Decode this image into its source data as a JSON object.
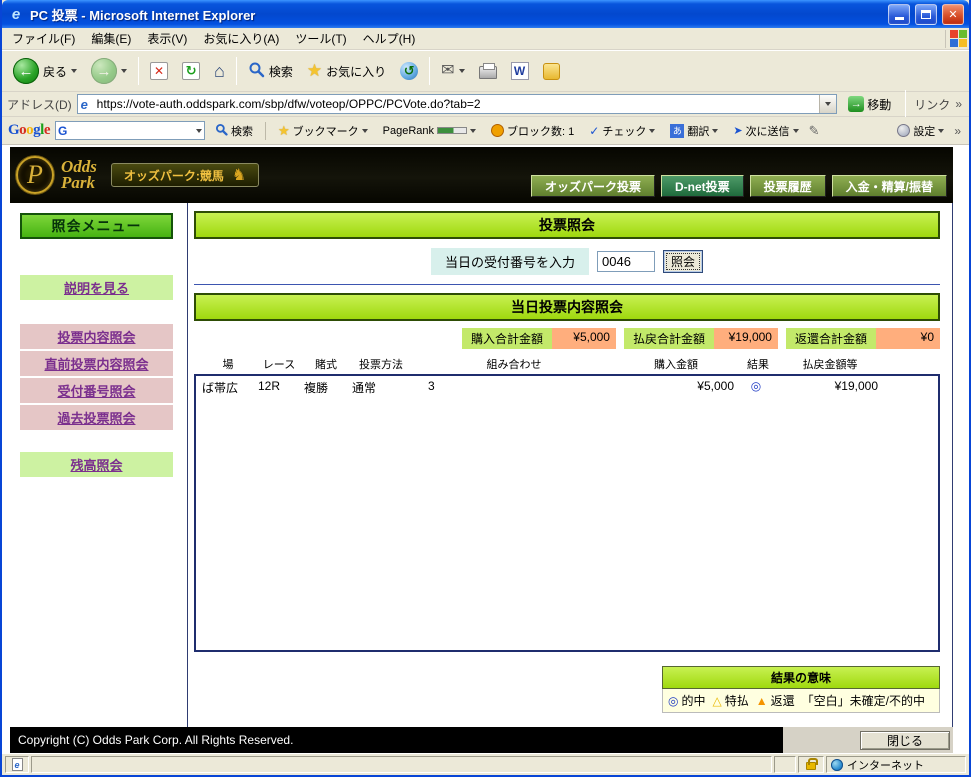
{
  "colors": {
    "titlebar_blue": "#0348CE",
    "chrome_gray": "#ECE9D8",
    "green_bar": "#A9DE28",
    "menu_green_dark": "#46B312",
    "sidebar_pink": "#E5C6C6",
    "sidebar_green": "#CDF2A2",
    "summary_label_green": "#C3E96A",
    "summary_value_salmon": "#FFAE7D",
    "nav_olive": "#6E8F3E",
    "nav_dark_green": "#1F6B3C",
    "link_purple": "#7B2F8E",
    "gold": "#D9B23A"
  },
  "window": {
    "title": "PC 投票 - Microsoft Internet Explorer"
  },
  "menubar": {
    "items": [
      "ファイル(F)",
      "編集(E)",
      "表示(V)",
      "お気に入り(A)",
      "ツール(T)",
      "ヘルプ(H)"
    ]
  },
  "toolbar": {
    "back_label": "戻る",
    "search_label": "検索",
    "favorites_label": "お気に入り"
  },
  "addressbar": {
    "label": "アドレス(D)",
    "url": "https://vote-auth.oddspark.com/sbp/dfw/voteop/OPPC/PCVote.do?tab=2",
    "go_label": "移動",
    "links_label": "リンク"
  },
  "googlebar": {
    "logo_letters": [
      "G",
      "o",
      "o",
      "g",
      "l",
      "e"
    ],
    "search_label": "検索",
    "bookmarks_label": "ブックマーク",
    "pagerank_label": "PageRank",
    "block_label": "ブロック数: 1",
    "check_label": "チェック",
    "translate_label": "翻訳",
    "send_label": "次に送信",
    "settings_label": "設定"
  },
  "site_header": {
    "brand_top": "Odds",
    "brand_bottom": "Park",
    "badge": "オッズパーク:競馬",
    "nav": [
      "オッズパーク投票",
      "D-net投票",
      "投票履歴",
      "入金・精算/振替"
    ]
  },
  "sidebar": {
    "title": "照会メニュー",
    "help_link": "説明を見る",
    "items": [
      "投票内容照会",
      "直前投票内容照会",
      "受付番号照会",
      "過去投票照会"
    ],
    "balance_link": "残高照会"
  },
  "main": {
    "inquiry_title": "投票照会",
    "receipt_label": "当日の受付番号を入力",
    "receipt_value": "0046",
    "inquiry_button": "照会",
    "today_title": "当日投票内容照会",
    "summary": [
      {
        "label": "購入合計金額",
        "value": "¥5,000"
      },
      {
        "label": "払戻合計金額",
        "value": "¥19,000"
      },
      {
        "label": "返還合計金額",
        "value": "¥0"
      }
    ],
    "table": {
      "headers": [
        "場",
        "レース",
        "賭式",
        "投票方法",
        "組み合わせ",
        "購入金額",
        "結果",
        "払戻金額等"
      ],
      "rows": [
        [
          "ば帯広",
          "12R",
          "複勝",
          "通常",
          "3",
          "¥5,000",
          "◎",
          "¥19,000"
        ]
      ]
    },
    "legend": {
      "title": "結果の意味",
      "items": [
        {
          "sym": "◎",
          "label": "的中"
        },
        {
          "sym": "△",
          "label": "特払"
        },
        {
          "sym": "▲",
          "label": "返還"
        },
        {
          "sym": "",
          "label": "「空白」未確定/不的中"
        }
      ]
    }
  },
  "footer": {
    "copyright": "Copyright (C) Odds Park Corp. All Rights Reserved.",
    "close_button": "閉じる"
  },
  "statusbar": {
    "zone": "インターネット"
  },
  "icons": {
    "ie_e": "e",
    "close": "✕",
    "back_arrow": "←",
    "forward_arrow": "→",
    "stop": "✕",
    "refresh": "↻",
    "home": "⌂",
    "star": "★",
    "history": "↺",
    "mail": "✉",
    "word": "W",
    "go_arrow": "→",
    "chevron": "»",
    "g_letter": "G",
    "check": "✓",
    "translate_char": "あ",
    "send_arrow": "➤",
    "pen": "✎",
    "horse": "♞",
    "brand_p": "P"
  }
}
